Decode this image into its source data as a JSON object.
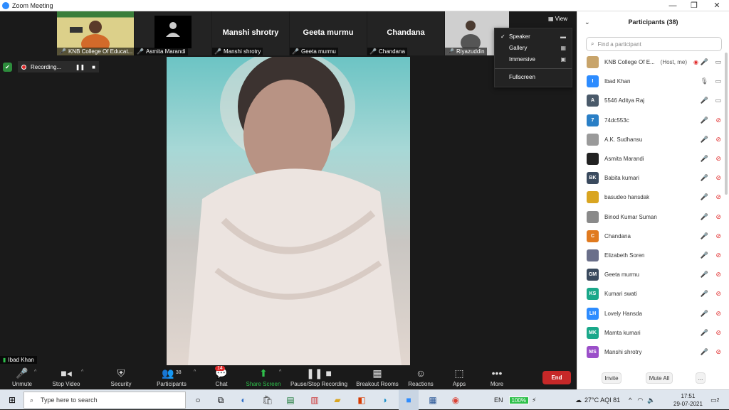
{
  "window": {
    "title": "Zoom Meeting",
    "minimize": "—",
    "maximize": "❐",
    "close": "✕"
  },
  "thumbnails": [
    {
      "name": "KNB College Of Educat...",
      "big": "",
      "kind": "photo"
    },
    {
      "name": "Asmita Marandi",
      "big": "",
      "kind": "avatar"
    },
    {
      "name": "Manshi shrotry",
      "big": "Manshi shrotry",
      "kind": "text"
    },
    {
      "name": "Geeta murmu",
      "big": "Geeta murmu",
      "kind": "text"
    },
    {
      "name": "Chandana",
      "big": "Chandana",
      "kind": "text"
    },
    {
      "name": "Riyazuddin",
      "big": "",
      "kind": "photo2"
    }
  ],
  "view_button": "View",
  "view_menu": {
    "items": [
      {
        "label": "Speaker",
        "checked": "✓"
      },
      {
        "label": "Gallery",
        "checked": ""
      },
      {
        "label": "Immersive",
        "checked": ""
      }
    ],
    "fullscreen": "Fullscreen"
  },
  "recording": {
    "label": "Recording..."
  },
  "speaker": {
    "name": "Ibad Khan"
  },
  "toolbar": {
    "unmute": "Unmute",
    "stop_video": "Stop Video",
    "security": "Security",
    "participants": "Participants",
    "participants_count": "38",
    "chat": "Chat",
    "chat_badge": "14",
    "share_screen": "Share Screen",
    "pause_stop": "Pause/Stop Recording",
    "breakout": "Breakout Rooms",
    "reactions": "Reactions",
    "apps": "Apps",
    "more": "More",
    "end": "End"
  },
  "panel": {
    "title": "Participants (38)",
    "search_placeholder": "Find a participant",
    "participants": [
      {
        "initials": "",
        "color": "#c8a46a",
        "name": "KNB College Of E...",
        "host": "(Host, me)",
        "mic_on": false,
        "cam_on": true,
        "rec": true
      },
      {
        "initials": "I",
        "color": "#2d8cff",
        "name": "Ibad Khan",
        "host": "",
        "mic_on": true,
        "cam_on": true,
        "rec": false
      },
      {
        "initials": "A",
        "color": "#4a5a6a",
        "name": "5546 Aditya Raj",
        "host": "",
        "mic_on": false,
        "cam_on": true,
        "rec": false
      },
      {
        "initials": "7",
        "color": "#2a7fc6",
        "name": "74dc553c",
        "host": "",
        "mic_on": false,
        "cam_on": false,
        "rec": false
      },
      {
        "initials": "",
        "color": "#9a9a9a",
        "name": "A.K. Sudhansu",
        "host": "",
        "mic_on": false,
        "cam_on": false,
        "rec": false
      },
      {
        "initials": "",
        "color": "#222222",
        "name": "Asmita Marandi",
        "host": "",
        "mic_on": false,
        "cam_on": false,
        "rec": false
      },
      {
        "initials": "BK",
        "color": "#3a4a5e",
        "name": "Babita kumari",
        "host": "",
        "mic_on": false,
        "cam_on": false,
        "rec": false
      },
      {
        "initials": "",
        "color": "#d9a521",
        "name": "basudeo hansdak",
        "host": "",
        "mic_on": false,
        "cam_on": false,
        "rec": false
      },
      {
        "initials": "",
        "color": "#8a8a8a",
        "name": "Binod Kumar Suman",
        "host": "",
        "mic_on": false,
        "cam_on": false,
        "rec": false
      },
      {
        "initials": "C",
        "color": "#e07a1f",
        "name": "Chandana",
        "host": "",
        "mic_on": false,
        "cam_on": false,
        "rec": false
      },
      {
        "initials": "",
        "color": "#6a6f8a",
        "name": "Elizabeth Soren",
        "host": "",
        "mic_on": false,
        "cam_on": false,
        "rec": false
      },
      {
        "initials": "GM",
        "color": "#3a4a5e",
        "name": "Geeta murmu",
        "host": "",
        "mic_on": false,
        "cam_on": false,
        "rec": false
      },
      {
        "initials": "KS",
        "color": "#1aa88a",
        "name": "Kumari swati",
        "host": "",
        "mic_on": false,
        "cam_on": false,
        "rec": false
      },
      {
        "initials": "LH",
        "color": "#2d8cff",
        "name": "Lovely Hansda",
        "host": "",
        "mic_on": false,
        "cam_on": false,
        "rec": false
      },
      {
        "initials": "MK",
        "color": "#1aa88a",
        "name": "Mamta kumari",
        "host": "",
        "mic_on": false,
        "cam_on": false,
        "rec": false
      },
      {
        "initials": "MS",
        "color": "#9b4fc9",
        "name": "Manshi shrotry",
        "host": "",
        "mic_on": false,
        "cam_on": false,
        "rec": false
      }
    ],
    "invite": "Invite",
    "mute_all": "Mute All",
    "more": "..."
  },
  "taskbar": {
    "search_placeholder": "Type here to search",
    "lang": "EN",
    "battery": "100%",
    "weather": "27°C  AQI 81",
    "time": "17:51",
    "date": "29-07-2021",
    "notif": "2"
  }
}
